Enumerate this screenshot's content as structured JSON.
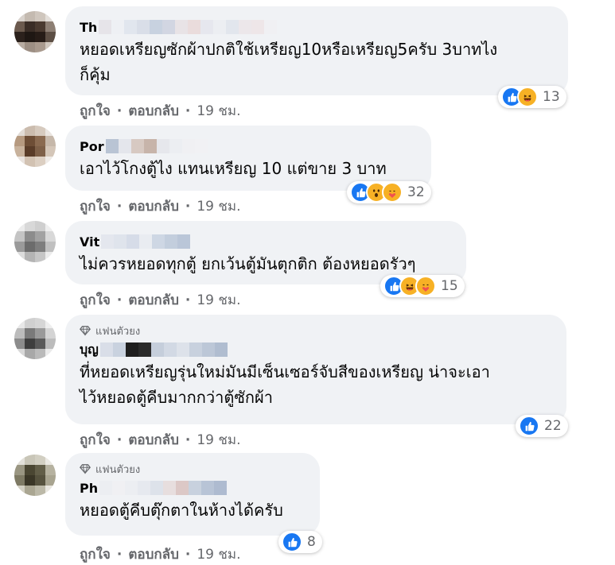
{
  "reaction_colors": {
    "like": "#1877f2",
    "emoji": "#f7b125"
  },
  "comments": [
    {
      "name": "Th",
      "badge": "",
      "lines": [
        "หยอดเหรียญซักผ้าปกติใช้เหรียญ10หรือเหรียญ5ครับ 3บาทไง",
        "ก็คุ้ม"
      ],
      "reactions": [
        "like-icon",
        "haha-icon"
      ],
      "reaction_count": "13",
      "like": "ถูกใจ",
      "reply": "ตอบกลับ",
      "time": "19 ชม."
    },
    {
      "name": "Por",
      "badge": "",
      "lines": [
        "เอาไว้โกงตู้ไง แทนเหรียญ 10 แต่ขาย 3 บาท"
      ],
      "reactions": [
        "like-icon",
        "wow-icon",
        "care-icon"
      ],
      "reaction_count": "32",
      "like": "ถูกใจ",
      "reply": "ตอบกลับ",
      "time": "19 ชม."
    },
    {
      "name": "Vit",
      "badge": "",
      "lines": [
        "ไม่ควรหยอดทุกตู้ ยกเว้นตู้มันตุกติก ต้องหยอดรัวๆ"
      ],
      "reactions": [
        "like-icon",
        "haha-icon",
        "care-icon"
      ],
      "reaction_count": "15",
      "like": "ถูกใจ",
      "reply": "ตอบกลับ",
      "time": "19 ชม."
    },
    {
      "name": "บุญ",
      "badge": "แฟนตัวยง",
      "lines": [
        "ที่หยอดเหรียญรุ่นใหม่มันมีเซ็นเซอร์จับสีของเหรียญ น่าจะเอา",
        "ไว้หยอดตู้คีบมากกว่าตู้ซักผ้า"
      ],
      "reactions": [
        "like-icon"
      ],
      "reaction_count": "22",
      "like": "ถูกใจ",
      "reply": "ตอบกลับ",
      "time": "19 ชม."
    },
    {
      "name": "Ph",
      "badge": "แฟนตัวยง",
      "lines": [
        "หยอดตู้คีบตุ๊กตาในห้างได้ครับ"
      ],
      "reactions": [
        "like-icon"
      ],
      "reaction_count": "8",
      "like": "ถูกใจ",
      "reply": "ตอบกลับ",
      "time": "19 ชม."
    }
  ]
}
